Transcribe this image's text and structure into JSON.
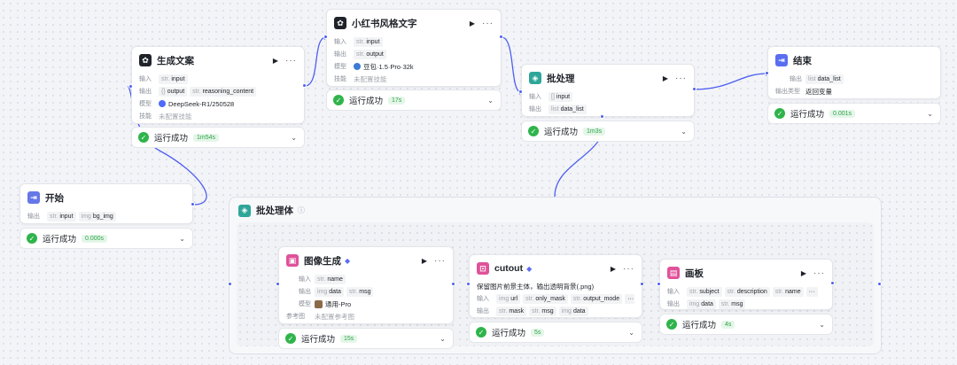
{
  "labels": {
    "input": "输入",
    "output": "输出",
    "model": "模型",
    "skill": "技能",
    "output_type": "输出类型",
    "reference": "参考图"
  },
  "icons": {
    "run": "play-icon",
    "more": "more-icon",
    "success": "check-circle-icon",
    "expand": "chevron-down-icon",
    "info": "info-icon"
  },
  "colors": {
    "accent": "#4d5ff0",
    "success": "#2fb44b",
    "success_badge_bg": "#e4f6e8"
  },
  "nodes": {
    "start": {
      "title": "开始",
      "outputs": [
        {
          "type": "str.",
          "name": "input"
        },
        {
          "type": "img",
          "name": "bg_img"
        }
      ],
      "status": "运行成功",
      "time": "0.000s"
    },
    "gen_copy": {
      "title": "生成文案",
      "inputs": [
        {
          "type": "str.",
          "name": "input"
        }
      ],
      "outputs": [
        {
          "type": "{}",
          "name": "output"
        },
        {
          "type": "str.",
          "name": "reasoning_content"
        }
      ],
      "model": "DeepSeek-R1/250528",
      "skill": "未配置技能",
      "status": "运行成功",
      "time": "1m54s"
    },
    "xhs_style": {
      "title": "小红书风格文字",
      "inputs": [
        {
          "type": "str.",
          "name": "input"
        }
      ],
      "outputs": [
        {
          "type": "str.",
          "name": "output"
        }
      ],
      "model": "豆包·1.5·Pro·32k",
      "skill": "未配置技能",
      "status": "运行成功",
      "time": "17s"
    },
    "batch_node": {
      "title": "批处理",
      "inputs": [
        {
          "type": "[]",
          "name": "input"
        }
      ],
      "outputs": [
        {
          "type": "list",
          "name": "data_list"
        }
      ],
      "status": "运行成功",
      "time": "1m3s"
    },
    "end": {
      "title": "结束",
      "outputs": [
        {
          "type": "list",
          "name": "data_list"
        }
      ],
      "output_type": "返回变量",
      "status": "运行成功",
      "time": "0.001s"
    },
    "batch_body": {
      "title": "批处理体"
    },
    "image_gen": {
      "title": "图像生成",
      "inputs": [
        {
          "type": "str.",
          "name": "name"
        }
      ],
      "outputs": [
        {
          "type": "img",
          "name": "data"
        },
        {
          "type": "str.",
          "name": "msg"
        }
      ],
      "model": "通用-Pro",
      "reference": "未配置参考图",
      "status": "运行成功",
      "time": "15s"
    },
    "cutout": {
      "title": "cutout",
      "description": "保留图片前景主体，输出透明背景(.png)",
      "inputs": [
        {
          "type": "img",
          "name": "url"
        },
        {
          "type": "str.",
          "name": "only_mask"
        },
        {
          "type": "str.",
          "name": "output_mode"
        }
      ],
      "outputs": [
        {
          "type": "str.",
          "name": "mask"
        },
        {
          "type": "str.",
          "name": "msg"
        },
        {
          "type": "img",
          "name": "data"
        }
      ],
      "more": "···",
      "status": "运行成功",
      "time": "5s"
    },
    "canvas": {
      "title": "画板",
      "inputs": [
        {
          "type": "str.",
          "name": "subject"
        },
        {
          "type": "str.",
          "name": "description"
        },
        {
          "type": "str.",
          "name": "name"
        }
      ],
      "outputs": [
        {
          "type": "img",
          "name": "data"
        },
        {
          "type": "str.",
          "name": "msg"
        }
      ],
      "more": "···",
      "status": "运行成功",
      "time": "4s"
    }
  }
}
